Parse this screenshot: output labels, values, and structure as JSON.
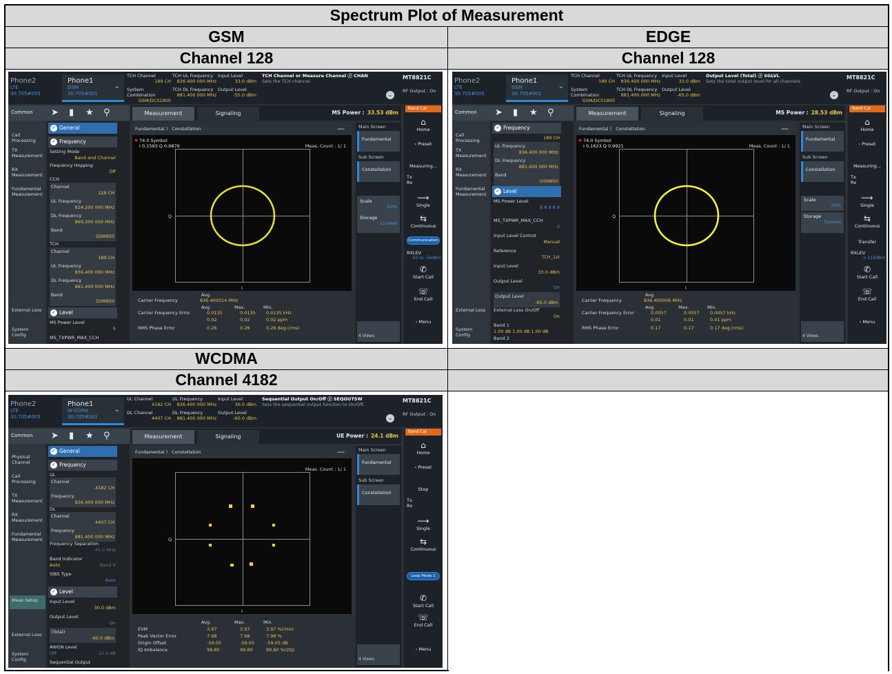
{
  "table": {
    "title": "Spectrum Plot of Measurement",
    "col_left": "GSM",
    "col_right": "EDGE",
    "channel_left": "Channel 128",
    "channel_right": "Channel 128",
    "col_left_2": "WCDMA",
    "channel_left_2": "Channel 4182"
  },
  "common": {
    "phone2": "Phone2",
    "phone2_lte": "LTE",
    "phone2_id": "30.705#005",
    "phone1": "Phone1",
    "model": "MT8821C",
    "rf_output": "RF Output : On",
    "nav_common": "Common",
    "tab_measurement": "Measurement",
    "tab_signaling": "Signaling",
    "breadcrumb": "Fundamental 〉 Constellation",
    "meas_count": "Meas. Count :    1/     1",
    "q": "Q",
    "i": "I",
    "main_screen": "Main Screen",
    "sub_screen": "Sub Screen",
    "fundamental": "Fundamental",
    "constellation": "Constellation",
    "home": "Home",
    "preset": "Preset",
    "single": "Single",
    "continuous": "Continuous",
    "start_call": "Start Call",
    "end_call": "End Call",
    "menu": "Menu",
    "views": "4 Views",
    "band_cal": "Band Cal",
    "avg": "Avg.",
    "max": "Max.",
    "min": "Min."
  },
  "gsm": {
    "phone1_std": "GSM",
    "phone1_id": "30.705#001",
    "p1k": "TCH Channel",
    "p1v": "189 CH",
    "p2k": "TCH UL Frequency",
    "p2v": "836.400 000 MHz",
    "p3k": "Input Level",
    "p3v": "33.0 dBm",
    "p4k": "System Combination",
    "p4v": "GSM/DCS1800",
    "p5k": "TCH DL Frequency",
    "p5v": "881.400 000 MHz",
    "p6k": "Output Level",
    "p6v": "-55.0 dBm",
    "help_t": "TCH Channel or Measure Channel ⓢ CHAN",
    "help_d": "Sets the TCH channel.",
    "power_label": "MS Power :",
    "power": "33.53 dBm",
    "nav": [
      "Call Processing",
      "TX Measurement",
      "RX Measurement",
      "Fundamental Measurement",
      "External Loss",
      "System Config"
    ],
    "g_general": "General",
    "g_frequency": "Frequency",
    "g_level": "Level",
    "setting_mode": "Setting Mode",
    "setting_mode_v": "Band and Channel",
    "freq_hop": "Frequency Hopping",
    "freq_hop_v": "Off",
    "cch": "CCH",
    "ch": "Channel",
    "cch_ch": "128 CH",
    "ulf": "UL Frequency",
    "cch_ul": "824.200 000 MHz",
    "dlf": "DL Frequency",
    "cch_dl": "869.200 000 MHz",
    "band": "Band",
    "band_v": "GSM850",
    "tch": "TCH",
    "tch_ch": "189 CH",
    "tch_ul": "836.400 000 MHz",
    "tch_dl": "881.400 000 MHz",
    "ms_pwr": "MS Power Level",
    "ms_pwr_v": "5",
    "txpwr": "MS_TXPWR_MAX_CCH",
    "sym": "74.0 Symbol",
    "iq": "I 0.1593 Q 0.9876",
    "r1": "Carrier Frequency",
    "r1a": "836.400014 MHz",
    "r2": "Carrier Frequency Error",
    "r2a": "0.0135",
    "r2m": "0.0135",
    "r2n": "0.0135 kHz",
    "r3a": "0.02",
    "r3m": "0.02",
    "r3n": "0.02 ppm",
    "r4": "RMS Phase Error",
    "r4a": "0.26",
    "r4m": "0.26",
    "r4n": "0.26 deg.(rms)",
    "scale": "Scale",
    "scale_v": "20%",
    "storage": "Storage",
    "storage_v": "Current",
    "measuring": "Measuring...",
    "tx": "Tx",
    "rx": "Rx",
    "comm": "Communication",
    "rxlev": "RXLEV",
    "rxlev_v": "-55 to -54dBm"
  },
  "edge": {
    "phone1_std": "GSM",
    "phone1_id": "30.705#001",
    "help_t": "Output Level (Total) ⓢ SGLVL",
    "help_d": "Sets the total output level for all channels.",
    "power": "28.53 dBm",
    "g_frequency": "Frequency",
    "g_level": "Level",
    "tch_ch": "189 CH",
    "ul": "UL Frequency",
    "ul_v": "836.400 000 MHz",
    "dl": "DL Frequency",
    "dl_v": "881.400 000 MHz",
    "band": "Band",
    "band_v": "GSM850",
    "ms_pwr": "MS Power Level",
    "ms_pwr_v": "8  8  8\n8  8",
    "txpwr": "MS_TXPWR_MAX_CCH",
    "txpwr_v": "0",
    "ilc": "Input Level Control",
    "ilc_v": "Manual",
    "ref": "Reference",
    "ref_v": "TCH_1st",
    "inlev": "Input Level",
    "inlev_v": "33.0 dBm",
    "outlev": "Output Level",
    "outlev_v": "On",
    "outlev2": "Output Level",
    "outlev2_v": "-65.0 dBm",
    "extloss": "External Loss On/Off",
    "extloss_v": "On",
    "band1": "Band 1",
    "band1_v": "1.00 dB  1.00 dB  1.00 dB",
    "band2": "Band 2",
    "sym": "74.0 Symbol",
    "iq": "I 0.1623 Q 0.9921",
    "r1a": "836.400006 MHz",
    "r2a": "0.0057",
    "r2m": "0.0057",
    "r2n": "0.0057 kHz",
    "r3a": "0.01",
    "r3m": "0.01",
    "r3n": "0.01 ppm",
    "r4a": "0.17",
    "r4m": "0.17",
    "r4n": "0.17 deg.(rms)",
    "transfer": "Transfer",
    "rxlev_v": "< 110dBm"
  },
  "wcdma": {
    "phone1_std": "W-CDMA",
    "phone1_id": "30.705#001",
    "p1k": "UL Channel",
    "p1v": "4182 CH",
    "p2k": "UL Frequency",
    "p2v": "836.400 000 MHz",
    "p3k": "Input Level",
    "p3v": "30.0 dBm",
    "p4k": "DL Channel",
    "p4v": "4407 CH",
    "p5k": "DL Frequency",
    "p5v": "881.400 000 MHz",
    "p6k": "Output Level",
    "p6v": "-60.0 dBm",
    "help_t": "Sequential Output On/Off ⓢ SEQOUTSW",
    "help_d": "Sets the sequential output function to On/Off.",
    "power_label": "UE Power :",
    "power": "24.1 dBm",
    "nav": [
      "Physical Channel",
      "Call Processing",
      "TX Measurement",
      "RX Measurement",
      "Fundamental Measurement",
      "Meas Setup",
      "External Loss",
      "System Config"
    ],
    "ul": "UL",
    "ch": "Channel",
    "ul_ch": "4182 CH",
    "freq": "Frequency",
    "ul_f": "836.400 000 MHz",
    "dl": "DL",
    "dl_ch": "4407 CH",
    "dl_f": "881.400 000 MHz",
    "fsep": "Frequency Separation",
    "fsep_v": "45.0 MHz",
    "bind": "Band Indicator",
    "bind_v": "Auto",
    "bind_v2": "Band V",
    "sib": "SIB5 Type",
    "sib_v": "Auto",
    "inlev": "Input Level",
    "inlev_v": "30.0 dBm",
    "outlev": "Output Level",
    "outlev_v": "On",
    "total": "(Total)",
    "total_v": "-60.0 dBm",
    "awgn": "AWGN Level",
    "awgn_v": "Off",
    "awgn_v2": "-20.0 dB",
    "seq": "Sequential Output",
    "r1": "EVM",
    "r1a": "3.97",
    "r1m": "3.97",
    "r1n": "3.97 %(rms)",
    "r2": "Peak Vector Error",
    "r2a": "7.98",
    "r2m": "7.98",
    "r2n": "7.98 %",
    "r3": "Origin Offset",
    "r3a": "-59.05",
    "r3m": "-59.05",
    "r3n": "-59.05 dB",
    "r4": "IQ Imbalance",
    "r4a": "99.80",
    "r4m": "99.80",
    "r4n": "99.80 %(I/Q)",
    "stop": "Stop",
    "loop": "Loop Mode 1"
  }
}
